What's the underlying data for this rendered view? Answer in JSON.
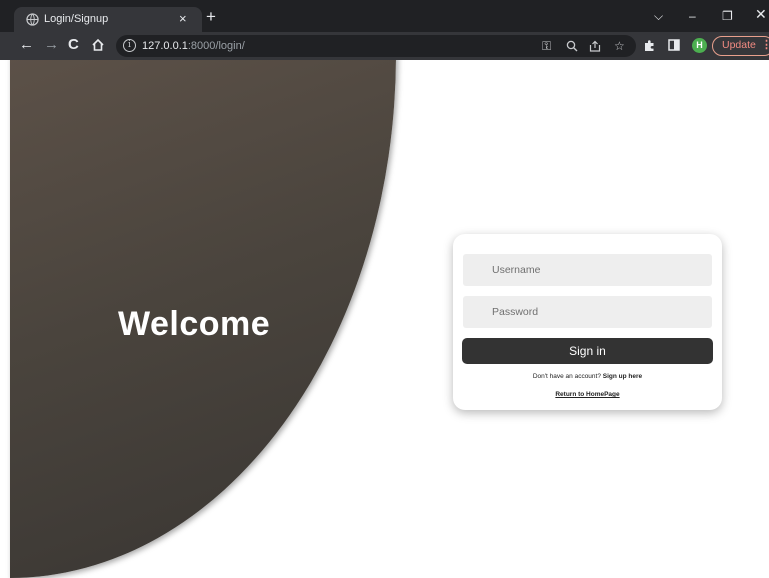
{
  "browser": {
    "tab_title": "Login/Signup",
    "tab_close": "×",
    "new_tab": "+",
    "url_host": "127.0.0.1",
    "url_path": ":8000/login/",
    "update_label": "Update",
    "profile_initial": "H",
    "icons": [
      "globe-icon",
      "back-icon",
      "forward-icon",
      "reload-icon",
      "home-icon",
      "info-icon",
      "key-icon",
      "zoom-icon",
      "share-icon",
      "star-icon",
      "extensions-icon",
      "sidepanel-icon",
      "menu-dots-icon",
      "tab-search-icon",
      "minimize-icon",
      "restore-icon",
      "close-icon"
    ]
  },
  "hero": {
    "title": "Welcome"
  },
  "login": {
    "username_placeholder": "Username",
    "password_placeholder": "Password",
    "signin_label": "Sign in",
    "no_account_text": "Don't have an account? ",
    "signup_link": "Sign up here",
    "home_link": "Return to HomePage"
  },
  "colors": {
    "hero_gradient": [
      "#5c5148",
      "#383532"
    ],
    "button": "#333333",
    "field_bg": "#eeeeee",
    "update_accent": "#f28b82"
  }
}
